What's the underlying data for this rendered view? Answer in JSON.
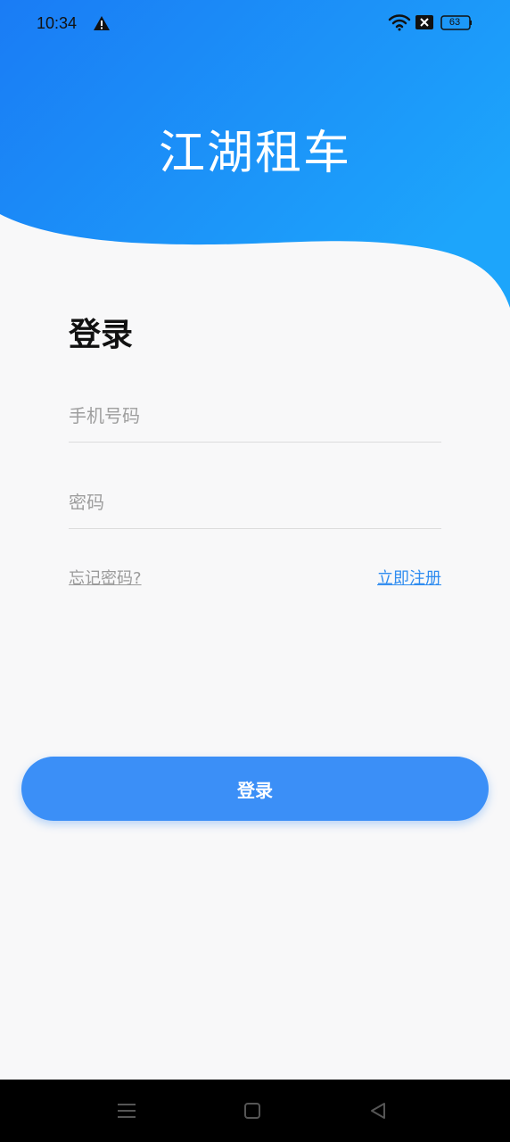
{
  "status": {
    "time": "10:34",
    "battery": "63",
    "icons": [
      "warning-icon",
      "wifi-icon",
      "close-box-icon",
      "battery-icon"
    ]
  },
  "app": {
    "title": "江湖租车"
  },
  "login": {
    "heading": "登录",
    "phone_placeholder": "手机号码",
    "password_placeholder": "密码",
    "forgot_password": "忘记密码?",
    "register": "立即注册",
    "submit": "登录"
  },
  "colors": {
    "gradient_start": "#1a7cf5",
    "gradient_end": "#1da5fb",
    "primary_button": "#3b8ff7",
    "register_link": "#2f8cf0",
    "background": "#f8f8f9"
  },
  "navigation": {
    "icons": [
      "menu-icon",
      "home-icon",
      "back-icon"
    ]
  }
}
